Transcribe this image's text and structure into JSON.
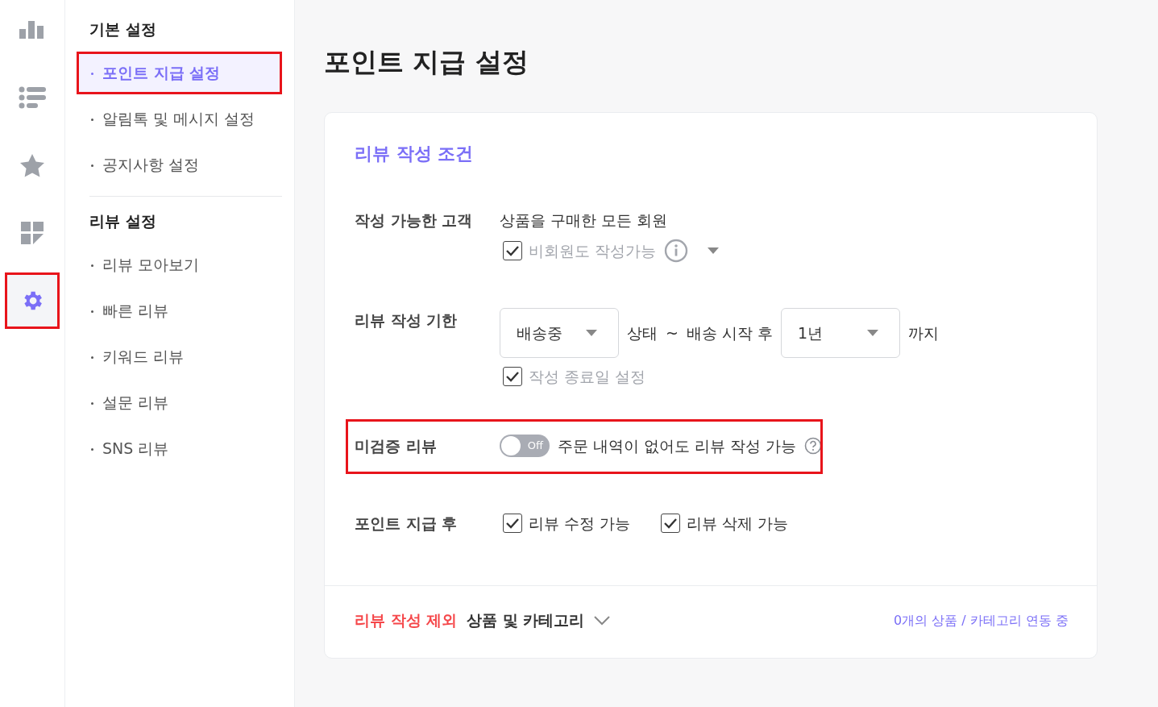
{
  "icon_rail": {
    "items": [
      {
        "kind": "chart",
        "selected": false,
        "highlighted": false
      },
      {
        "kind": "list",
        "selected": false,
        "highlighted": false
      },
      {
        "kind": "star",
        "selected": false,
        "highlighted": false
      },
      {
        "kind": "tiles",
        "selected": false,
        "highlighted": false
      },
      {
        "kind": "gear",
        "selected": true,
        "highlighted": true
      }
    ]
  },
  "menu": {
    "sections": [
      {
        "title": "기본 설정",
        "items": [
          {
            "label": "포인트 지급 설정",
            "selected": true,
            "highlighted": true
          },
          {
            "label": "알림톡 및 메시지 설정",
            "selected": false,
            "highlighted": false
          },
          {
            "label": "공지사항 설정",
            "selected": false,
            "highlighted": false
          }
        ]
      },
      {
        "title": "리뷰 설정",
        "items": [
          {
            "label": "리뷰 모아보기",
            "selected": false,
            "highlighted": false
          },
          {
            "label": "빠른 리뷰",
            "selected": false,
            "highlighted": false
          },
          {
            "label": "키워드 리뷰",
            "selected": false,
            "highlighted": false
          },
          {
            "label": "설문 리뷰",
            "selected": false,
            "highlighted": false
          },
          {
            "label": "SNS 리뷰",
            "selected": false,
            "highlighted": false
          }
        ]
      }
    ]
  },
  "page_title": "포인트 지급 설정",
  "card": {
    "title": "리뷰 작성 조건",
    "rows": [
      {
        "kind": "customer",
        "label": "작성 가능한 고객",
        "text": "상품을 구매한 모든 회원",
        "option": {
          "label": "비회원도 작성가능",
          "checked": true,
          "disabled": true
        },
        "highlighted": false
      },
      {
        "kind": "period",
        "label": "리뷰 작성 기한",
        "status_select": "배송중",
        "text_1": "상태",
        "separator": "~",
        "text_2": "배송 시작 후",
        "period_select": "1년",
        "text_3": "까지",
        "option": {
          "label": "작성 종료일 설정",
          "checked": true,
          "disabled": true
        },
        "highlighted": false
      },
      {
        "kind": "toggle",
        "label": "미검증 리뷰",
        "on": false,
        "toggle_text": "Off",
        "description": "주문 내역이 없어도 리뷰 작성 가능",
        "highlighted": true
      },
      {
        "kind": "checks",
        "label": "포인트 지급 후",
        "options": [
          {
            "label": "리뷰 수정 가능",
            "checked": true,
            "disabled": false
          },
          {
            "label": "리뷰 삭제 가능",
            "checked": true,
            "disabled": false
          }
        ],
        "highlighted": false
      }
    ],
    "footer": {
      "title_highlight": "리뷰 작성 제외",
      "title_rest": "상품 및 카테고리",
      "expanded": false,
      "status": "0개의 상품 / 카테고리 연동 중"
    }
  }
}
